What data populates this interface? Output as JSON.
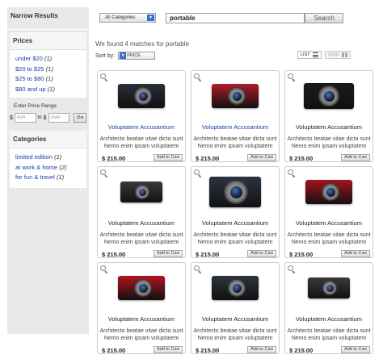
{
  "sidebar": {
    "title": "Narrow Results",
    "prices": {
      "heading": "Prices",
      "items": [
        {
          "label": "under $20",
          "count": "(1)"
        },
        {
          "label": "$20 to $25",
          "count": "(1)"
        },
        {
          "label": "$25 to $80",
          "count": "(1)"
        },
        {
          "label": "$80 and up",
          "count": "(1)"
        }
      ],
      "range_label": "Enter Price Range",
      "currency": "$",
      "to": "to",
      "min_placeholder": "min",
      "max_placeholder": "max",
      "go_label": "Go"
    },
    "categories": {
      "heading": "Categories",
      "items": [
        {
          "label": "limited edition",
          "count": "(1)"
        },
        {
          "label": "at work & home",
          "count": "(2)"
        },
        {
          "label": "for fun & travel",
          "count": "(1)"
        }
      ]
    }
  },
  "search": {
    "category": "All Categories",
    "query": "portable",
    "button": "Search"
  },
  "results": {
    "summary": "We found 4 matches for portable",
    "sort_label": "Sort by:",
    "sort_value": "PRICE",
    "view_list": "LIST",
    "view_grid": "GRID"
  },
  "products": [
    {
      "name": "Voluptatem Accusantium",
      "linked": true,
      "desc1": "Architecto beatae vitae dicta sunt",
      "desc2": "Nemo enim ipsam voluptatem",
      "price": "$ 215.00",
      "cart": "Add to Cart",
      "color": "#2a2f38",
      "style": "compact"
    },
    {
      "name": "Voluptatem Accusantium",
      "linked": true,
      "desc1": "Architecto beatae vitae dicta sunt",
      "desc2": "Nemo enim ipsam voluptatem",
      "price": "$ 215.00",
      "cart": "Add to Cart",
      "color": "#b01a26",
      "style": "compact"
    },
    {
      "name": "Voluptatem Accusantium",
      "linked": false,
      "desc1": "Architecto beatae vitae dicta sunt",
      "desc2": "Nemo enim ipsam voluptatem",
      "price": "$ 215.00",
      "cart": "Add to Cart",
      "color": "#1a1a1a",
      "style": "bridge"
    },
    {
      "name": "Voluptatem Accusantium",
      "linked": false,
      "desc1": "Architecto beatae vitae dicta sunt",
      "desc2": "Nemo enim ipsam voluptatem",
      "price": "$ 215.00",
      "cart": "Add to Cart",
      "color": "#3a3a3a",
      "style": "slim"
    },
    {
      "name": "Voluptatem Accusantium",
      "linked": false,
      "desc1": "Architecto beatae vitae dicta sunt",
      "desc2": "Nemo enim ipsam voluptatem",
      "price": "$ 215.00",
      "cart": "Add to Cart",
      "color": "#2b3443",
      "style": "superzoom"
    },
    {
      "name": "Voluptatem Accusantium",
      "linked": false,
      "desc1": "Architecto beatae vitae dicta sunt",
      "desc2": "Nemo enim ipsam voluptatem",
      "price": "$ 215.00",
      "cart": "Add to Cart",
      "color": "#a8141f",
      "style": "compact"
    },
    {
      "name": "Voluptatem Accusantium",
      "linked": false,
      "desc1": "Architecto beatae vitae dicta sunt",
      "desc2": "Nemo enim ipsam voluptatem",
      "price": "$ 215.00",
      "cart": "Add to Cart",
      "color": "#b3121e",
      "style": "compact"
    },
    {
      "name": "Voluptatem Accusantium",
      "linked": false,
      "desc1": "Architecto beatae vitae dicta sunt",
      "desc2": "Nemo enim ipsam voluptatem",
      "price": "$ 215.00",
      "cart": "Add to Cart",
      "color": "#2c3440",
      "style": "compact"
    },
    {
      "name": "Voluptatem Accusantium",
      "linked": false,
      "desc1": "Architecto beatae vitae dicta sunt",
      "desc2": "Nemo enim ipsam voluptatem",
      "price": "$ 215.00",
      "cart": "Add to Cart",
      "color": "#3a3a3a",
      "style": "slim"
    }
  ]
}
